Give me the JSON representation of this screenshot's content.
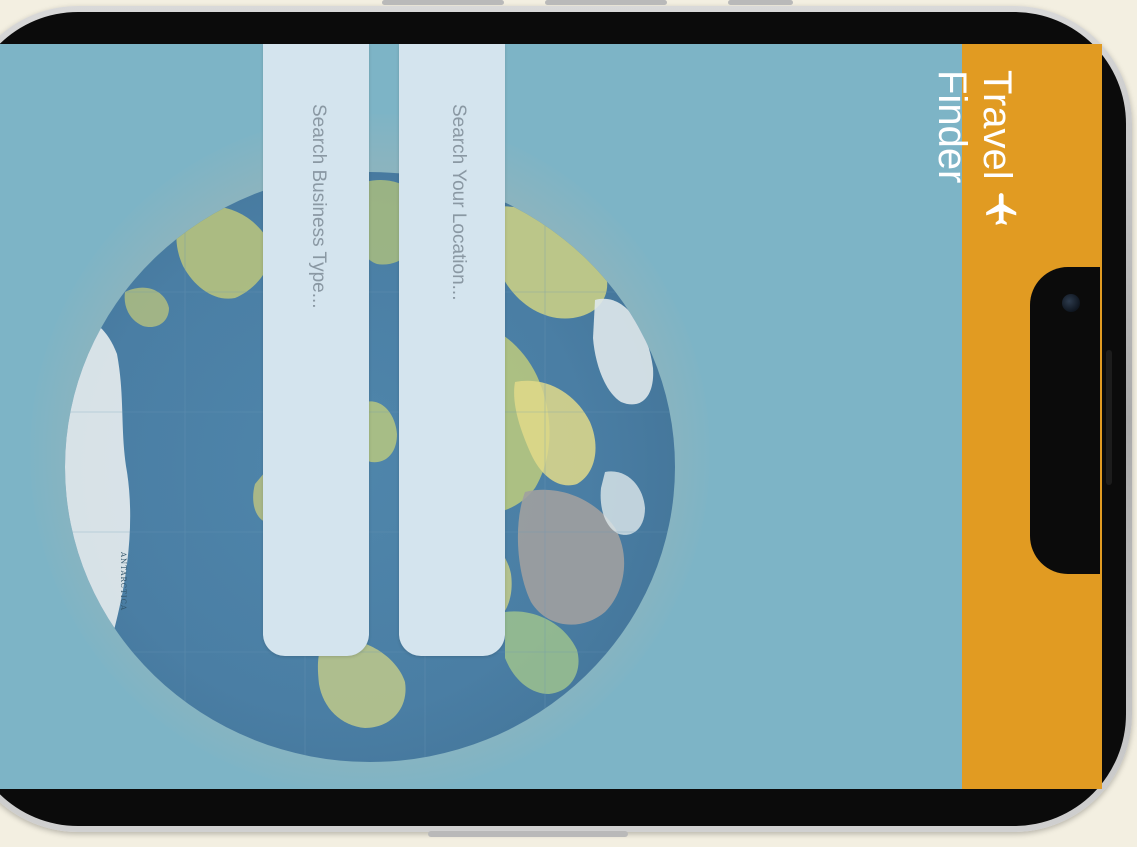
{
  "header": {
    "title_line1": "Travel",
    "title_line2": "Finder",
    "icon": "airplane-icon"
  },
  "search": {
    "location_placeholder": "Search Your Location...",
    "business_placeholder": "Search Business Type..."
  },
  "map": {
    "label": "ANTARCTICA"
  },
  "colors": {
    "screen_background": "#7db4c6",
    "header_accent": "#e19b22",
    "search_field": "#d4e4ee",
    "page_background": "#f3efe1"
  }
}
